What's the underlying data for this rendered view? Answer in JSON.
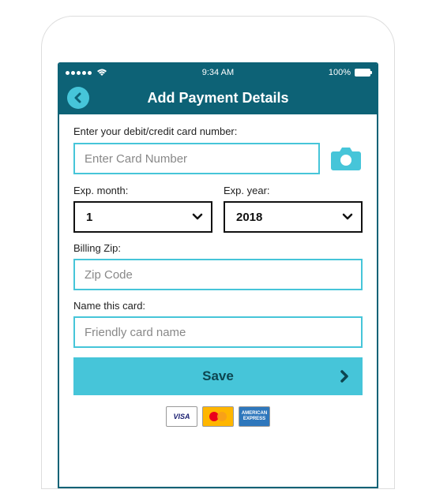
{
  "status": {
    "time": "9:34 AM",
    "battery": "100%"
  },
  "header": {
    "title": "Add Payment Details"
  },
  "form": {
    "card_label": "Enter your debit/credit card number:",
    "card_placeholder": "Enter Card Number",
    "exp_month_label": "Exp. month:",
    "exp_month_value": "1",
    "exp_year_label": "Exp. year:",
    "exp_year_value": "2018",
    "zip_label": "Billing Zip:",
    "zip_placeholder": "Zip Code",
    "name_label": "Name this card:",
    "name_placeholder": "Friendly card name",
    "save_label": "Save"
  },
  "logos": {
    "visa": "VISA",
    "amex": "AMERICAN EXPRESS"
  },
  "colors": {
    "primary_dark": "#0d6276",
    "primary_light": "#46c5d9"
  }
}
